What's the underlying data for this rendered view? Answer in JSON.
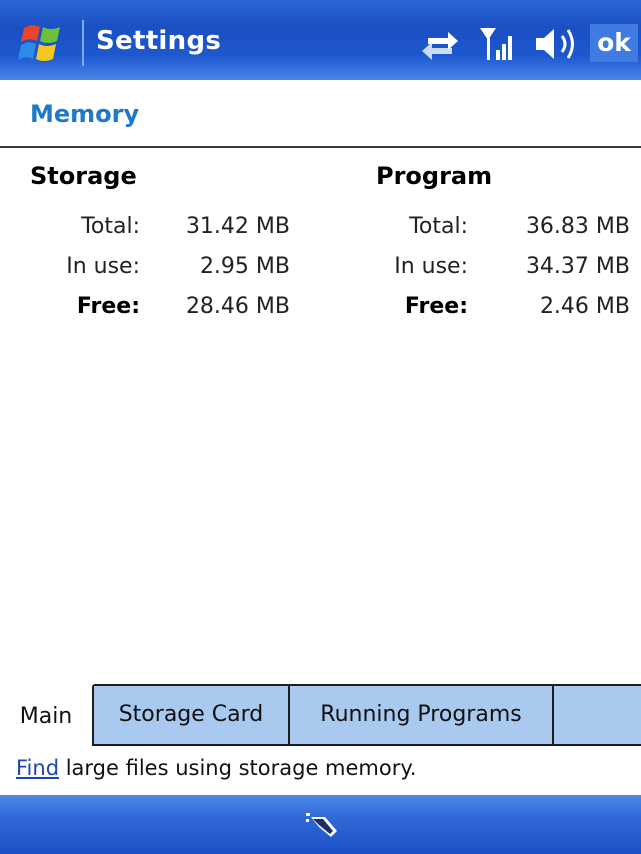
{
  "titlebar": {
    "title": "Settings",
    "ok_label": "ok",
    "icons": [
      "windows-start-icon",
      "connectivity-arrows-icon",
      "signal-strength-icon",
      "speaker-icon"
    ]
  },
  "page": {
    "title": "Memory"
  },
  "storage": {
    "heading": "Storage",
    "total_label": "Total:",
    "total_value": "31.42 MB",
    "in_use_label": "In use:",
    "in_use_value": "2.95 MB",
    "free_label": "Free:",
    "free_value": "28.46 MB"
  },
  "program": {
    "heading": "Program",
    "total_label": "Total:",
    "total_value": "36.83 MB",
    "in_use_label": "In use:",
    "in_use_value": "34.37 MB",
    "free_label": "Free:",
    "free_value": "2.46 MB"
  },
  "tabs": {
    "items": [
      {
        "label": "Main"
      },
      {
        "label": "Storage Card"
      },
      {
        "label": "Running Programs"
      }
    ],
    "active": "Main"
  },
  "footer": {
    "find_link": "Find",
    "find_text": " large files using storage memory."
  },
  "bottombar": {
    "icons": [
      "input-panel-icon"
    ]
  },
  "colors": {
    "titlebar_blue": "#1d58cf",
    "page_title": "#1f78c8",
    "tab_bar": "#a9c9ef",
    "link": "#1b45b8"
  }
}
